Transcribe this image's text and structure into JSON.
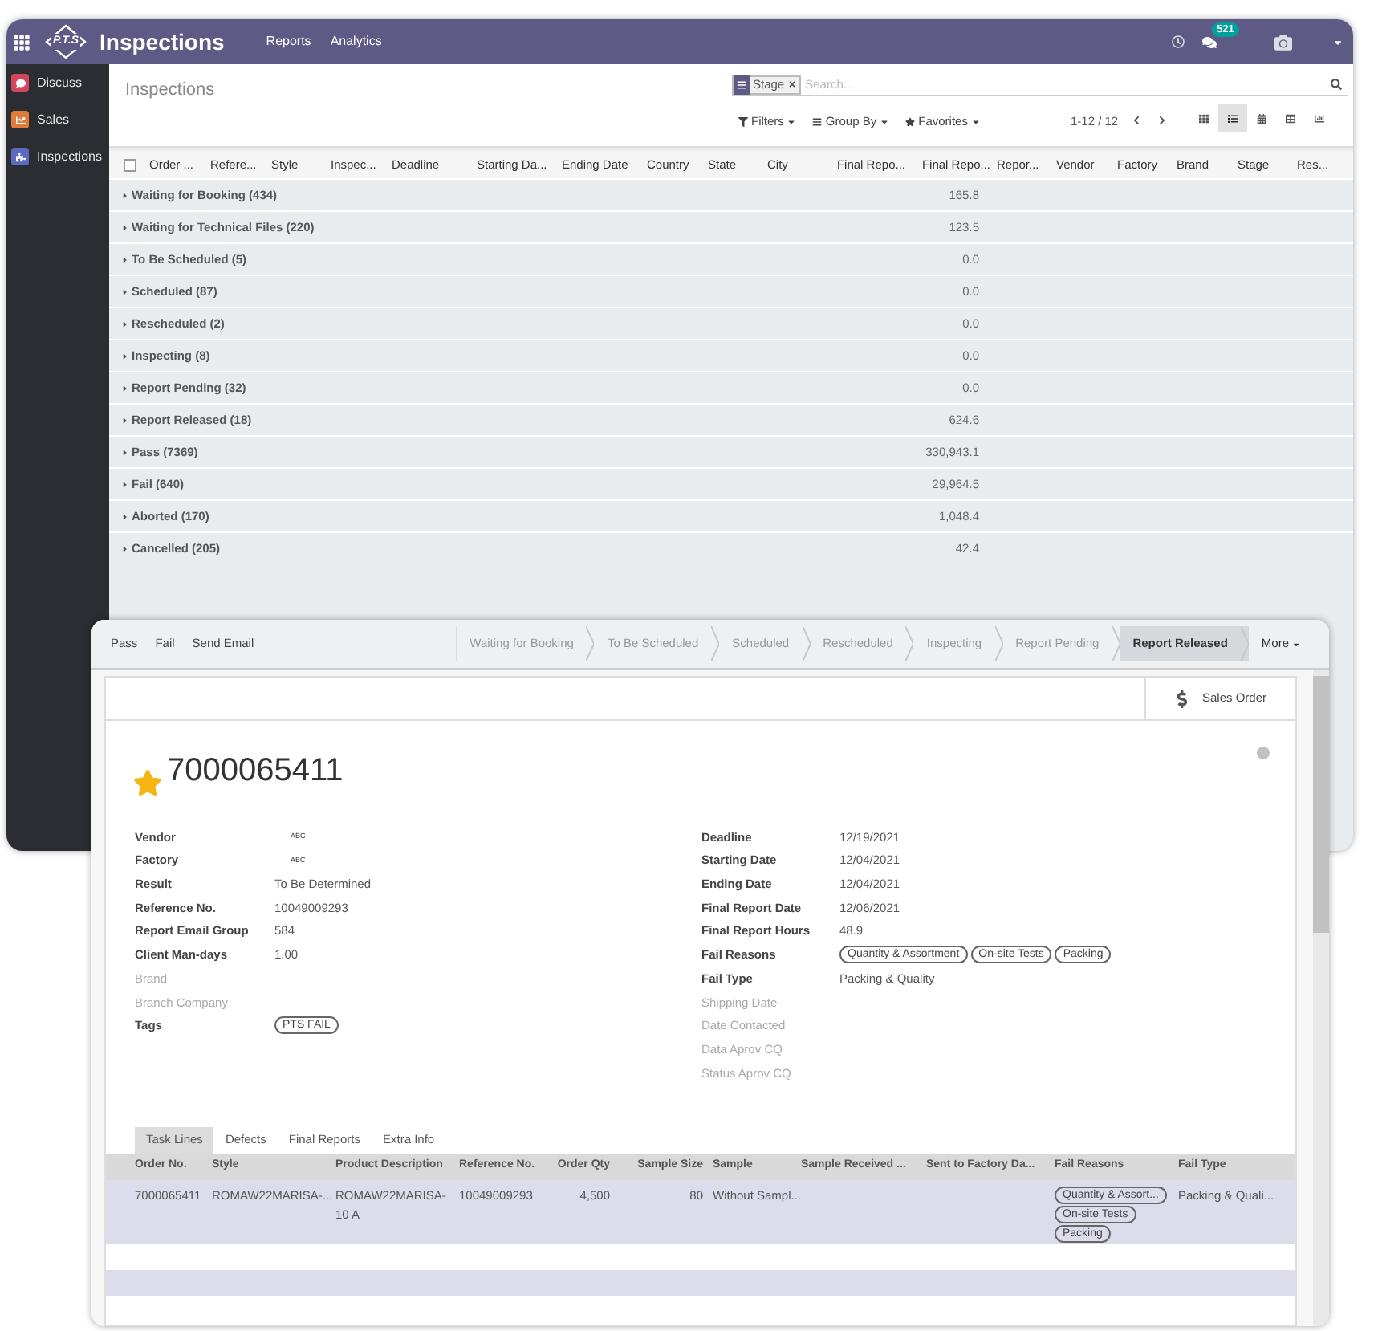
{
  "app": {
    "brand": "P.T.S",
    "title": "Inspections",
    "menus": [
      "Reports",
      "Analytics"
    ],
    "badge": "521"
  },
  "sidebar": {
    "items": [
      {
        "label": "Discuss",
        "color": "#d4455f"
      },
      {
        "label": "Sales",
        "color": "#e07b39"
      },
      {
        "label": "Inspections",
        "color": "#5c6bc0"
      }
    ]
  },
  "control_panel": {
    "breadcrumb": "Inspections",
    "facet": "Stage",
    "placeholder": "Search...",
    "buttons": [
      "Filters",
      "Group By",
      "Favorites"
    ],
    "pager": "1-12 / 12",
    "views": [
      {
        "kind": "kanban",
        "selected": false
      },
      {
        "kind": "list",
        "selected": true
      },
      {
        "kind": "calendar",
        "selected": false
      },
      {
        "kind": "pivot",
        "selected": false
      },
      {
        "kind": "graph",
        "selected": false
      }
    ]
  },
  "list": {
    "select_all": {
      "checked": false
    },
    "columns": [
      "Order ...",
      "Refere...",
      "Style",
      "Inspec...",
      "Deadline",
      "Starting Da...",
      "Ending Date",
      "Country",
      "State",
      "City",
      "Final Repo...",
      "Final Repo...",
      "Repor...",
      "Vendor",
      "Factory",
      "Brand",
      "Stage",
      "Res..."
    ],
    "groups": [
      {
        "label": "Waiting for Booking (434)",
        "value": "165.8"
      },
      {
        "label": "Waiting for Technical Files (220)",
        "value": "123.5"
      },
      {
        "label": "To Be Scheduled (5)",
        "value": "0.0"
      },
      {
        "label": "Scheduled (87)",
        "value": "0.0"
      },
      {
        "label": "Rescheduled (2)",
        "value": "0.0"
      },
      {
        "label": "Inspecting (8)",
        "value": "0.0"
      },
      {
        "label": "Report Pending (32)",
        "value": "0.0"
      },
      {
        "label": "Report Released (18)",
        "value": "624.6"
      },
      {
        "label": "Pass (7369)",
        "value": "330,943.1"
      },
      {
        "label": "Fail (640)",
        "value": "29,964.5"
      },
      {
        "label": "Aborted (170)",
        "value": "1,048.4"
      },
      {
        "label": "Cancelled (205)",
        "value": "42.4"
      }
    ]
  },
  "form": {
    "actions": [
      "Pass",
      "Fail",
      "Send Email"
    ],
    "stages": [
      {
        "label": "Waiting for Booking",
        "selected": false
      },
      {
        "label": "To Be Scheduled",
        "selected": false
      },
      {
        "label": "Scheduled",
        "selected": false
      },
      {
        "label": "Rescheduled",
        "selected": false
      },
      {
        "label": "Inspecting",
        "selected": false
      },
      {
        "label": "Report Pending",
        "selected": false
      },
      {
        "label": "Report Released",
        "selected": true
      }
    ],
    "more": "More",
    "smart_button": "Sales Order",
    "title": "7000065411",
    "starred": true,
    "left_fields": [
      {
        "label": "Vendor",
        "kind": "logo",
        "value": "ABC"
      },
      {
        "label": "Factory",
        "kind": "logo",
        "value": "ABC"
      },
      {
        "label": "Result",
        "kind": "text",
        "value": "To Be Determined"
      },
      {
        "label": "Reference No.",
        "kind": "text",
        "value": "10049009293"
      },
      {
        "label": "Report Email Group",
        "kind": "text",
        "value": "584"
      },
      {
        "label": "Client Man-days",
        "kind": "text",
        "value": "1.00"
      },
      {
        "label": "Brand"
      },
      {
        "label": "Branch Company"
      },
      {
        "label": "Tags",
        "kind": "tags",
        "tags": [
          "PTS FAIL"
        ]
      }
    ],
    "right_fields": [
      {
        "label": "Deadline",
        "kind": "text",
        "value": "12/19/2021"
      },
      {
        "label": "Starting Date",
        "kind": "text",
        "value": "12/04/2021"
      },
      {
        "label": "Ending Date",
        "kind": "text",
        "value": "12/04/2021"
      },
      {
        "label": "Final Report Date",
        "kind": "text",
        "value": "12/06/2021"
      },
      {
        "label": "Final Report Hours",
        "kind": "text",
        "value": "48.9"
      },
      {
        "label": "Fail Reasons",
        "kind": "tags",
        "tags": [
          "Quantity & Assortment",
          "On-site Tests",
          "Packing"
        ]
      },
      {
        "label": "Fail Type",
        "kind": "text",
        "value": "Packing & Quality"
      },
      {
        "label": "Shipping Date"
      },
      {
        "label": "Date Contacted"
      },
      {
        "label": "Data Aprov CQ"
      },
      {
        "label": "Status Aprov CQ"
      }
    ],
    "tabs": [
      {
        "label": "Task Lines",
        "selected": true
      },
      {
        "label": "Defects",
        "selected": false
      },
      {
        "label": "Final Reports",
        "selected": false
      },
      {
        "label": "Extra Info",
        "selected": false
      }
    ],
    "table": {
      "columns": [
        "Order No.",
        "Style",
        "Product Description",
        "Reference No.",
        "Order Qty",
        "Sample Size",
        "Sample",
        "Sample Received ...",
        "Sent to Factory Da...",
        "Fail Reasons",
        "Fail Type"
      ],
      "rows": [
        {
          "order_no": "7000065411",
          "style": "ROMAW22MARISA-...",
          "description": "ROMAW22MARISA-10 A",
          "reference": "10049009293",
          "order_qty": "4,500",
          "sample_size": "80",
          "sample": "Without Sampl...",
          "fail_reasons": [
            "Quantity & Assort...",
            "On-site Tests",
            "Packing"
          ],
          "fail_type": "Packing & Quali..."
        }
      ]
    }
  }
}
